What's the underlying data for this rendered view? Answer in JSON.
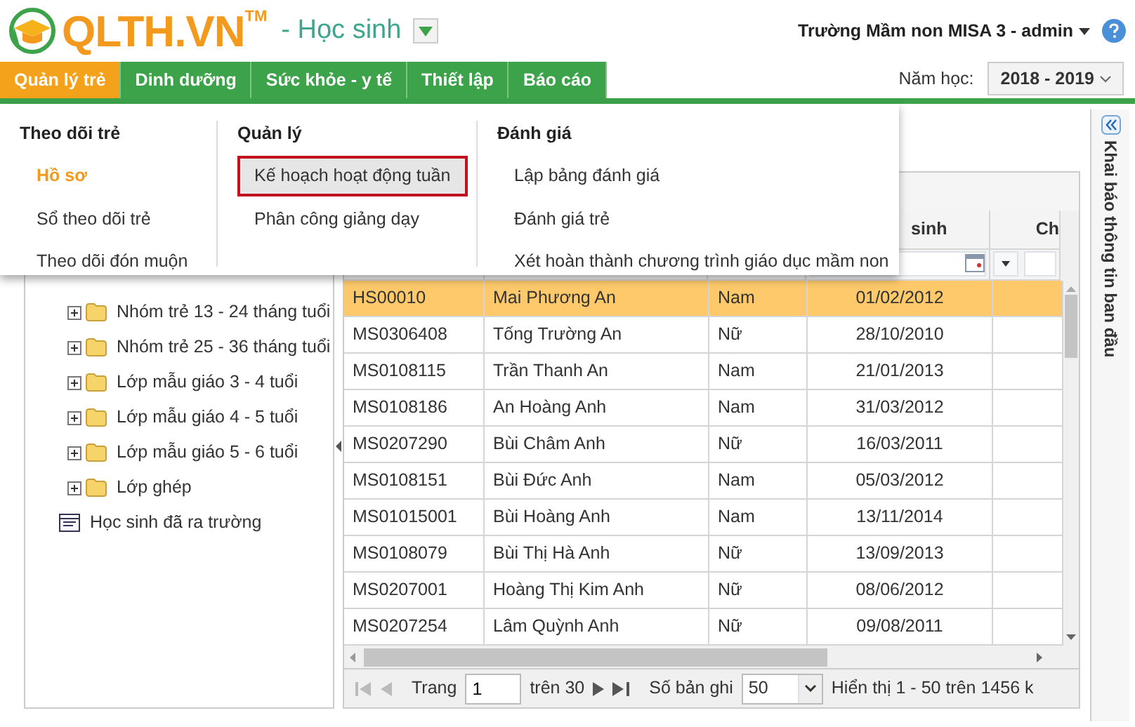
{
  "logo": {
    "text": "QLTH.VN",
    "mark": "TM"
  },
  "module": "- Học sinh",
  "user": "Trường Mầm non MISA 3 - admin",
  "tabs": [
    {
      "label": "Quản lý trẻ",
      "selected": true
    },
    {
      "label": "Dinh dưỡng",
      "selected": false
    },
    {
      "label": "Sức khỏe - y tế",
      "selected": false
    },
    {
      "label": "Thiết lập",
      "selected": false
    },
    {
      "label": "Báo cáo",
      "selected": false
    }
  ],
  "school_year": {
    "label": "Năm học:",
    "value": "2018 - 2019"
  },
  "menu": [
    {
      "heading": "Theo dõi trẻ",
      "items": [
        {
          "label": "Hồ sơ",
          "selected": true,
          "hovered": false
        },
        {
          "label": "Sổ theo dõi trẻ",
          "selected": false,
          "hovered": false
        },
        {
          "label": "Theo dõi đón muộn",
          "selected": false,
          "hovered": false
        }
      ]
    },
    {
      "heading": "Quản lý",
      "items": [
        {
          "label": "Kế hoạch hoạt động tuần",
          "selected": false,
          "hovered": true
        },
        {
          "label": "Phân công giảng dạy",
          "selected": false,
          "hovered": false
        }
      ]
    },
    {
      "heading": "Đánh giá",
      "items": [
        {
          "label": "Lập bảng đánh giá",
          "selected": false,
          "hovered": false
        },
        {
          "label": "Đánh giá trẻ",
          "selected": false,
          "hovered": false
        },
        {
          "label": "Xét hoàn thành chương trình giáo dục mầm non",
          "selected": false,
          "hovered": false
        }
      ]
    }
  ],
  "tree": [
    {
      "kind": "folder",
      "label": "Nhóm trẻ 13 - 24 tháng tuổi"
    },
    {
      "kind": "folder",
      "label": "Nhóm trẻ 25 - 36 tháng tuổi"
    },
    {
      "kind": "folder",
      "label": "Lớp mẫu giáo 3 - 4 tuổi"
    },
    {
      "kind": "folder",
      "label": "Lớp mẫu giáo 4 - 5 tuổi"
    },
    {
      "kind": "folder",
      "label": "Lớp mẫu giáo 5 - 6 tuổi"
    },
    {
      "kind": "folder",
      "label": "Lớp ghép"
    },
    {
      "kind": "list",
      "label": "Học sinh đã ra trường"
    }
  ],
  "grid": {
    "headers": [
      "sinh",
      "Ch"
    ],
    "rows": [
      {
        "cells": [
          "HS00010",
          "Mai Phương An",
          "Nam",
          "01/02/2012"
        ],
        "selected": true
      },
      {
        "cells": [
          "MS0306408",
          "Tống Trường An",
          "Nữ",
          "28/10/2010"
        ],
        "selected": false
      },
      {
        "cells": [
          "MS0108115",
          "Trần Thanh An",
          "Nam",
          "21/01/2013"
        ],
        "selected": false
      },
      {
        "cells": [
          "MS0108186",
          "An Hoàng Anh",
          "Nam",
          "31/03/2012"
        ],
        "selected": false
      },
      {
        "cells": [
          "MS0207290",
          "Bùi Châm Anh",
          "Nữ",
          "16/03/2011"
        ],
        "selected": false
      },
      {
        "cells": [
          "MS0108151",
          "Bùi Đức Anh",
          "Nam",
          "05/03/2012"
        ],
        "selected": false
      },
      {
        "cells": [
          "MS01015001",
          "Bùi Hoàng Anh",
          "Nam",
          "13/11/2014"
        ],
        "selected": false
      },
      {
        "cells": [
          "MS0108079",
          "Bùi Thị Hà Anh",
          "Nữ",
          "13/09/2013"
        ],
        "selected": false
      },
      {
        "cells": [
          "MS0207001",
          "Hoàng Thị Kim Anh",
          "Nữ",
          "08/06/2012"
        ],
        "selected": false
      },
      {
        "cells": [
          "MS0207254",
          "Lâm Quỳnh Anh",
          "Nữ",
          "09/08/2011"
        ],
        "selected": false
      }
    ]
  },
  "pager": {
    "page_label": "Trang",
    "page": "1",
    "of": "trên 30",
    "size_label": "Số bản ghi",
    "size": "50",
    "summary": "Hiển thị 1 - 50 trên 1456 k"
  },
  "side_panel": {
    "title": "Khai báo thông tin ban đầu"
  }
}
